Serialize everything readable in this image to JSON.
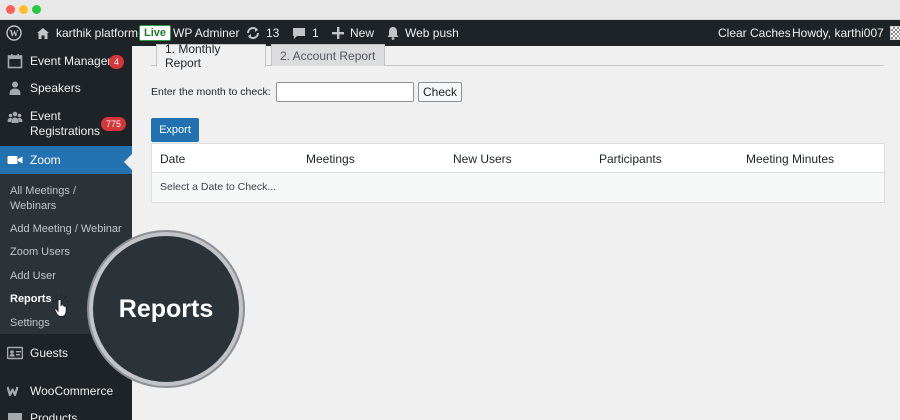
{
  "window": {
    "controls": [
      "close",
      "minimize",
      "maximize"
    ]
  },
  "adminbar": {
    "site_icon": "wordpress-icon",
    "home_icon": "home-icon",
    "site_name": "karthik platform",
    "live_badge": "Live",
    "role_label": "WP Adminer",
    "updates_icon": "refresh-icon",
    "updates_count": "13",
    "comments_icon": "comment-icon",
    "comments_count": "1",
    "new_icon": "plus-icon",
    "new_label": "New",
    "push_icon": "bell-icon",
    "push_label": "Web push",
    "clear_caches_label": "Clear Caches",
    "howdy_label": "Howdy, karthi007",
    "avatar_icon": "avatar-icon"
  },
  "sidebar": {
    "items": [
      {
        "label": "Event Manager",
        "icon": "calendar-icon",
        "badge": "4"
      },
      {
        "label": "Speakers",
        "icon": "person-icon"
      },
      {
        "label": "Event Registrations",
        "label_line1": "Event",
        "label_line2": "Registrations",
        "icon": "group-icon",
        "badge": "775"
      },
      {
        "label": "Zoom",
        "icon": "video-icon",
        "active": true
      },
      {
        "label": "Guests",
        "icon": "id-card-icon"
      },
      {
        "label": "WooCommerce",
        "icon": "woocommerce-icon"
      },
      {
        "label": "Products",
        "icon": "box-icon"
      }
    ],
    "submenu": [
      {
        "label": "All Meetings / Webinars",
        "line1": "All Meetings /",
        "line2": "Webinars"
      },
      {
        "label": "Add Meeting / Webinar"
      },
      {
        "label": "Zoom Users"
      },
      {
        "label": "Add User"
      },
      {
        "label": "Reports",
        "current": true
      },
      {
        "label": "Settings"
      }
    ]
  },
  "main": {
    "tabs": [
      {
        "label": "1. Monthly Report",
        "active": true
      },
      {
        "label": "2. Account Report",
        "active": false
      }
    ],
    "month_prompt": "Enter the month to check:",
    "month_input_value": "",
    "month_input_placeholder": "",
    "check_button": "Check",
    "export_button": "Export",
    "table": {
      "columns": [
        "Date",
        "Meetings",
        "New Users",
        "Participants",
        "Meeting Minutes"
      ],
      "empty_message": "Select a Date to Check..."
    }
  },
  "callout": {
    "text": "Reports"
  },
  "colors": {
    "adminbar_bg": "#1d2327",
    "sidebar_bg": "#1d2327",
    "submenu_bg": "#2c3338",
    "accent": "#2271b1",
    "badge": "#d63638",
    "live_green": "#1d7a2c",
    "content_bg": "#f0f0f1"
  }
}
